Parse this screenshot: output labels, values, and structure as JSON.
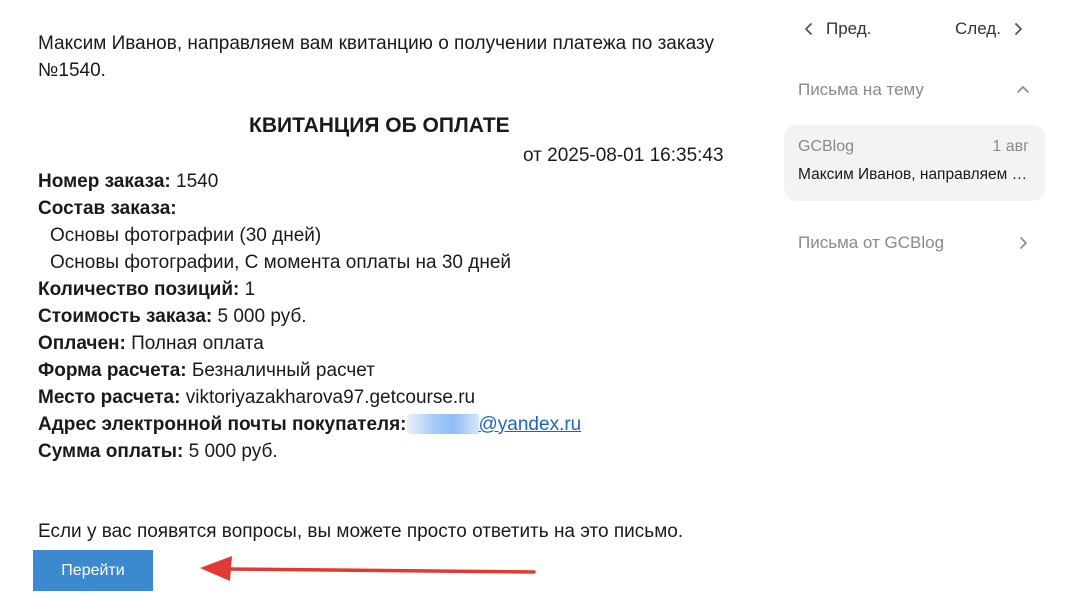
{
  "email": {
    "greeting": "Максим Иванов, направляем вам квитанцию о получении платежа по заказу №1540.",
    "receipt_title": "КВИТАНЦИЯ ОБ ОПЛАТЕ",
    "receipt_date": "от 2025-08-01 16:35:43",
    "order_number_label": "Номер заказа:",
    "order_number_value": " 1540",
    "order_items_label": "Состав заказа:",
    "order_items": [
      "Основы фотографии (30 дней)",
      "Основы фотографии, С момента оплаты на 30 дней"
    ],
    "positions_label": "Количество позиций:",
    "positions_value": " 1",
    "cost_label": "Стоимость заказа:",
    "cost_value": " 5 000 руб.",
    "paid_label": "Оплачен:",
    "paid_value": " Полная оплата",
    "payment_form_label": "Форма расчета:",
    "payment_form_value": " Безналичный расчет",
    "payment_place_label": "Место расчета:",
    "payment_place_value": " viktoriyazakharova97.getcourse.ru",
    "email_label": "Адрес электронной почты покупателя:",
    "email_value_domain": "@yandex.ru",
    "sum_label": "Сумма оплаты:",
    "sum_value": " 5 000 руб.",
    "footer_note": "Если у вас появятся вопросы, вы можете просто ответить на это письмо.",
    "go_button": "Перейти",
    "annotation_arrow_color": "#e03a33",
    "button_color": "#3d89cf",
    "link_color": "#1a66c7"
  },
  "sidebar": {
    "prev_label": "Пред.",
    "next_label": "След.",
    "thread_section_title": "Письма на тему",
    "thread_card": {
      "sender": "GCBlog",
      "date": "1 авг",
      "preview": "Максим Иванов, направляем вам квитанцию"
    },
    "from_section_title": "Письма от GCBlog"
  }
}
